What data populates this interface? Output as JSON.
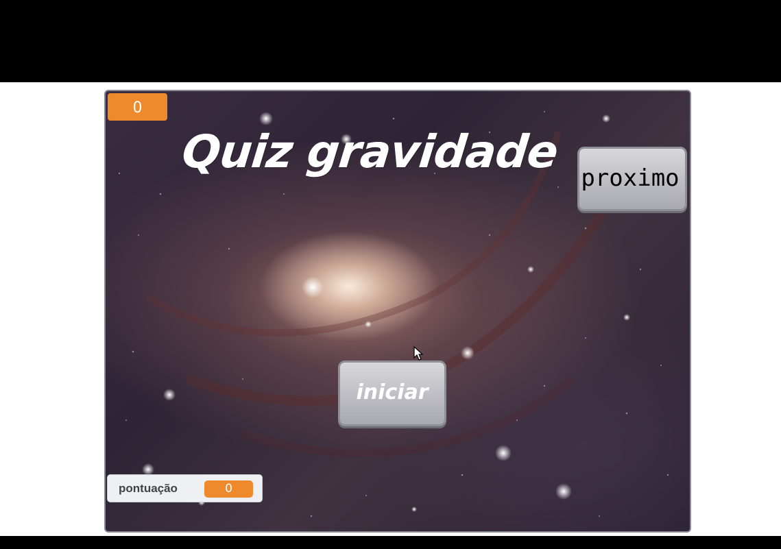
{
  "stage": {
    "top_counter": "0",
    "title": "Quiz gravidade",
    "next_button_label": "proximo",
    "start_button_label": "iniciar",
    "score_monitor": {
      "label": "pontuação",
      "value": "0"
    }
  },
  "colors": {
    "monitor_orange": "#ee8a2b",
    "button_grey": "#bdbdc3",
    "stage_border": "#8a8a96"
  },
  "icons": [
    "mouse-cursor-icon"
  ]
}
